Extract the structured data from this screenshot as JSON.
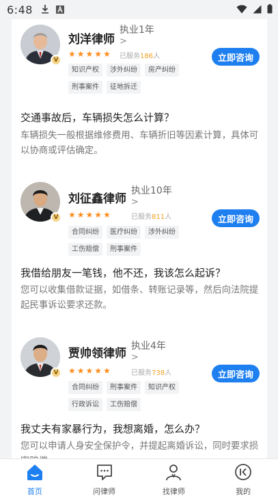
{
  "status_bar": {
    "time": "6:48",
    "left_icons": [
      "download-icon",
      "font-icon"
    ],
    "right_icons": [
      "wifi-icon",
      "signal-icon",
      "battery-icon"
    ]
  },
  "feed": {
    "cards": [
      {
        "name": "刘洋律师",
        "experience": "执业1年",
        "arrow": ">",
        "served_prefix": "已服务",
        "served_count": "186",
        "served_suffix": "人",
        "rating": 5,
        "consult_label": "立即咨询",
        "tags": [
          "知识产权",
          "涉外纠纷",
          "房产纠纷",
          "刑事案件",
          "征地拆迁"
        ],
        "question": "交通事故后，车辆损失怎么计算？",
        "answer": "车辆损失一般根据维修费用、车辆折旧等因素计算，具体可以协商或评估确定。"
      },
      {
        "name": "刘征鑫律师",
        "experience": "执业10年",
        "arrow": ">",
        "served_prefix": "已服务",
        "served_count": "811",
        "served_suffix": "人",
        "rating": 5,
        "consult_label": "立即咨询",
        "tags": [
          "合同纠纷",
          "医疗纠纷",
          "涉外纠纷",
          "工伤赔偿",
          "刑事案件"
        ],
        "question": "我借给朋友一笔钱，他不还，我该怎么起诉？",
        "answer": "您可以收集借款证据，如借条、转账记录等，然后向法院提起民事诉讼要求还款。"
      },
      {
        "name": "贾帅领律师",
        "experience": "执业4年",
        "arrow": ">",
        "served_prefix": "已服务",
        "served_count": "738",
        "served_suffix": "人",
        "rating": 5,
        "consult_label": "立即咨询",
        "tags": [
          "合同纠纷",
          "刑事案件",
          "知识产权",
          "行政诉讼",
          "工伤赔偿"
        ],
        "question": "我丈夫有家暴行为，我想离婚，怎么办？",
        "answer": "您可以申请人身安全保护令，并提起离婚诉讼，同时要求损害赔偿。"
      }
    ]
  },
  "tab_bar": {
    "active": 0,
    "tabs": [
      {
        "label": "首页",
        "icon": "home-icon"
      },
      {
        "label": "问律师",
        "icon": "chat-icon"
      },
      {
        "label": "找律师",
        "icon": "find-lawyer-icon"
      },
      {
        "label": "我的",
        "icon": "profile-icon"
      }
    ]
  },
  "colors": {
    "accent": "#1e7ff0",
    "star": "#ff8c1a",
    "served_count": "#f0a020",
    "background": "#f2f3f5"
  }
}
